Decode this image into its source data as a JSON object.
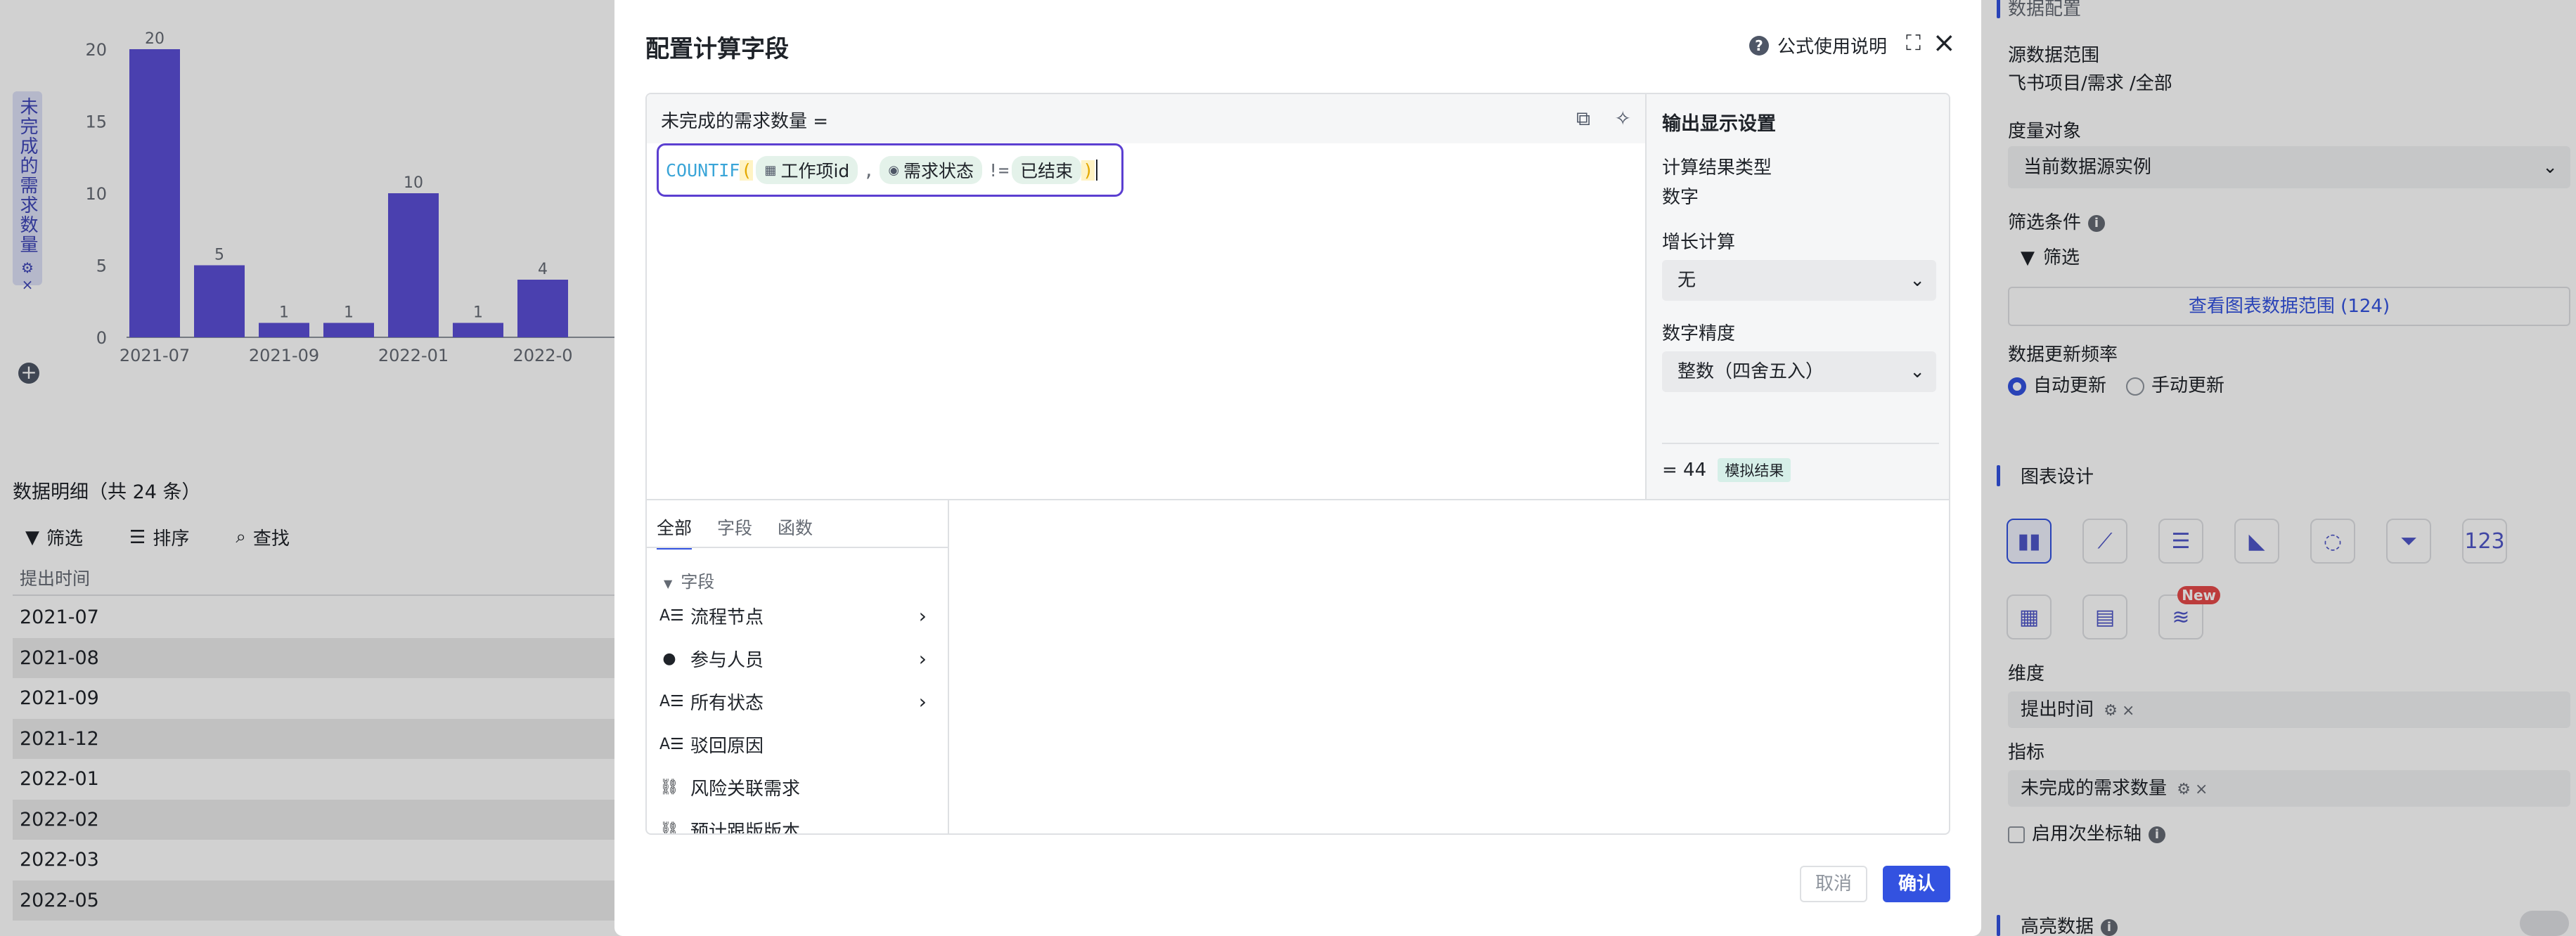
{
  "background": {
    "y_axis_tag": "未完成的需求数量",
    "detail_title": "数据明细（共 24 条）",
    "tools": {
      "filter": "筛选",
      "sort": "排序",
      "find": "查找"
    },
    "column_header": "提出时间",
    "rows": [
      "2021-07",
      "2021-08",
      "2021-09",
      "2021-12",
      "2022-01",
      "2022-02",
      "2022-03",
      "2022-05"
    ]
  },
  "chart_data": {
    "type": "bar",
    "categories": [
      "2021-07",
      "2021-08",
      "2021-09",
      "2021-12",
      "2022-01",
      "2022-02",
      "2022-03"
    ],
    "values": [
      20,
      5,
      1,
      1,
      10,
      1,
      4
    ],
    "x_tick_labels": [
      "2021-07",
      "2021-09",
      "2022-01",
      "2022-0"
    ],
    "y_ticks": [
      "0",
      "5",
      "10",
      "15",
      "20"
    ],
    "ylim": [
      0,
      20
    ],
    "bar_color": "#5b4fd6",
    "data_labels": [
      "20",
      "5",
      "1",
      "1",
      "10",
      "1",
      "4"
    ]
  },
  "right_panel": {
    "section_data": "数据配置",
    "source_range_label": "源数据范围",
    "source_range_value": "飞书项目/需求 /全部",
    "measure_label": "度量对象",
    "measure_value": "当前数据源实例",
    "filter_cond_label": "筛选条件",
    "filter_btn": "筛选",
    "view_range_btn": "查看图表数据范围 (124)",
    "update_freq_label": "数据更新频率",
    "auto_update": "自动更新",
    "manual_update": "手动更新",
    "section_design": "图表设计",
    "new_badge": "New",
    "dimension_label": "维度",
    "dimension_chip": "提出时间",
    "metric_label": "指标",
    "metric_chip": "未完成的需求数量",
    "secondary_axis": "启用次坐标轴",
    "highlight": "高亮数据",
    "accent": "#3352e0"
  },
  "modal": {
    "title": "配置计算字段",
    "help": "公式使用说明",
    "formula_name": "未完成的需求数量 =",
    "formula": {
      "fn": "COUNTIF",
      "open": "(",
      "token1": "工作项id",
      "comma": ",",
      "token2": "需求状态",
      "op": "!=",
      "str": "已结束",
      "close": ")"
    },
    "output": {
      "title": "输出显示设置",
      "result_type_label": "计算结果类型",
      "result_type_value": "数字",
      "growth_label": "增长计算",
      "growth_value": "无",
      "precision_label": "数字精度",
      "precision_value": "整数（四舍五入）",
      "result": "= 44",
      "sim_tag": "模拟结果"
    },
    "tabs": [
      "全部",
      "字段",
      "函数"
    ],
    "group_head": "字段",
    "fields": [
      {
        "label": "流程节点",
        "icon": "text-field-icon",
        "has_arrow": true
      },
      {
        "label": "参与人员",
        "icon": "person-icon",
        "has_arrow": true
      },
      {
        "label": "所有状态",
        "icon": "text-field-icon",
        "has_arrow": true
      },
      {
        "label": "驳回原因",
        "icon": "text-field-icon",
        "has_arrow": false
      },
      {
        "label": "风险关联需求",
        "icon": "link-icon",
        "has_arrow": false
      },
      {
        "label": "预计跟版版本",
        "icon": "link-icon",
        "has_arrow": false
      }
    ],
    "cancel": "取消",
    "confirm": "确认"
  }
}
